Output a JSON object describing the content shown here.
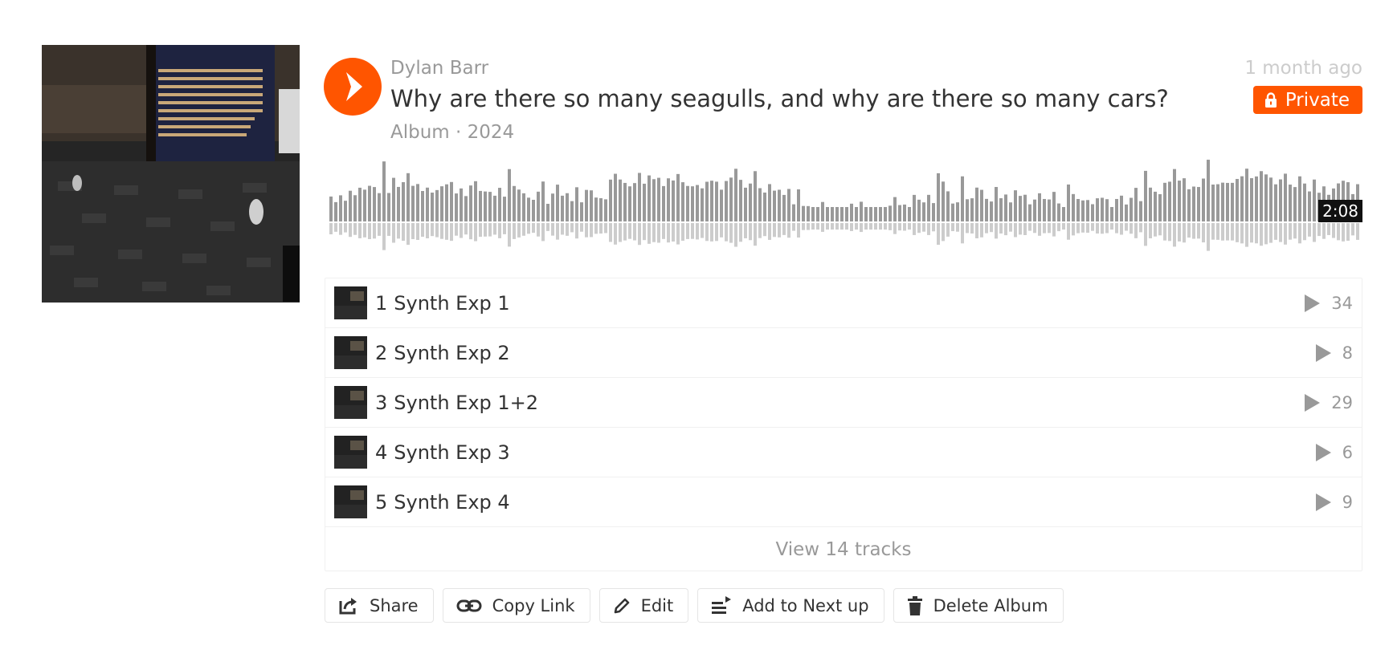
{
  "header": {
    "artist": "Dylan Barr",
    "title": "Why are there so many seagulls, and why are there so many cars?",
    "subtitle": "Album · 2024",
    "age": "1 month ago",
    "privacy_label": "Private"
  },
  "waveform": {
    "time": "2:08",
    "played_fraction": 0
  },
  "tracks": [
    {
      "num": "1",
      "title": "Synth Exp 1",
      "plays": "34"
    },
    {
      "num": "2",
      "title": "Synth Exp 2",
      "plays": "8"
    },
    {
      "num": "3",
      "title": "Synth Exp 1+2",
      "plays": "29"
    },
    {
      "num": "4",
      "title": "Synth Exp 3",
      "plays": "6"
    },
    {
      "num": "5",
      "title": "Synth Exp 4",
      "plays": "9"
    }
  ],
  "view_all_label": "View 14 tracks",
  "actions": {
    "share": "Share",
    "copy_link": "Copy Link",
    "edit": "Edit",
    "add_next": "Add to Next up",
    "delete": "Delete Album"
  },
  "colors": {
    "accent": "#ff5500",
    "wave_top": "#999999",
    "wave_bottom": "#cccccc"
  }
}
